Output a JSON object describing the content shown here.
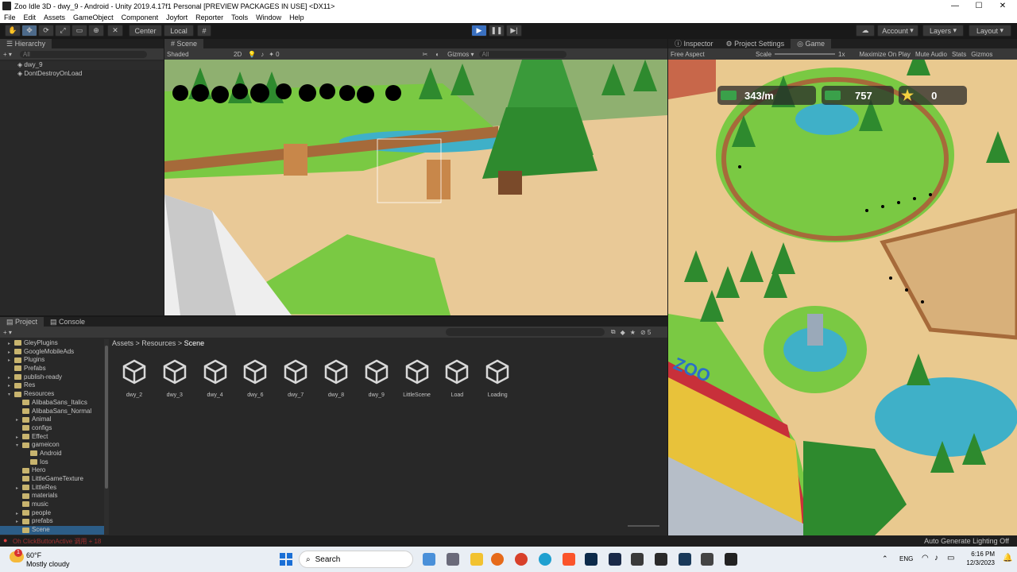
{
  "window": {
    "title": "Zoo Idle 3D - dwy_9 - Android - Unity 2019.4.17f1 Personal [PREVIEW PACKAGES IN USE] <DX11>",
    "minimize": "—",
    "maximize": "☐",
    "close": "✕"
  },
  "menu": [
    "File",
    "Edit",
    "Assets",
    "GameObject",
    "Component",
    "Joyfort",
    "Reporter",
    "Tools",
    "Window",
    "Help"
  ],
  "toolbar": {
    "center_label": "Center",
    "local_label": "Local",
    "account_label": "Account",
    "layers_label": "Layers",
    "layout_label": "Layout"
  },
  "hierarchy": {
    "tab": "Hierarchy",
    "search_placeholder": "All",
    "items": [
      "dwy_9",
      "DontDestroyOnLoad"
    ]
  },
  "scene": {
    "tab": "Scene",
    "shading": "Shaded",
    "mode_2d": "2D",
    "gizmos": "Gizmos",
    "search_placeholder": "All",
    "fx_count": "0"
  },
  "game": {
    "tabs": [
      "Inspector",
      "Project Settings",
      "Game"
    ],
    "aspect": "Free Aspect",
    "scale_label": "Scale",
    "scale_value": "1x",
    "maximize_on_play": "Maximize On Play",
    "mute_audio": "Mute Audio",
    "stats": "Stats",
    "gizmos": "Gizmos",
    "hud": {
      "income_rate": "343/m",
      "cash": "757",
      "stars": "0"
    },
    "zoo_sign": "ZOO"
  },
  "project": {
    "tabs": [
      "Project",
      "Console"
    ],
    "breadcrumb": [
      "Assets",
      "Resources",
      "Scene"
    ],
    "tree": [
      {
        "label": "GleyPlugins",
        "indent": 1,
        "arrow": "▸"
      },
      {
        "label": "GoogleMobileAds",
        "indent": 1,
        "arrow": "▸"
      },
      {
        "label": "Plugins",
        "indent": 1,
        "arrow": "▸"
      },
      {
        "label": "Prefabs",
        "indent": 1,
        "arrow": ""
      },
      {
        "label": "publish-ready",
        "indent": 1,
        "arrow": "▸"
      },
      {
        "label": "Res",
        "indent": 1,
        "arrow": "▸"
      },
      {
        "label": "Resources",
        "indent": 1,
        "arrow": "▾"
      },
      {
        "label": "AlibabaSans_Italics",
        "indent": 2,
        "arrow": ""
      },
      {
        "label": "AlibabaSans_Normal",
        "indent": 2,
        "arrow": ""
      },
      {
        "label": "Animal",
        "indent": 2,
        "arrow": "▸"
      },
      {
        "label": "configs",
        "indent": 2,
        "arrow": ""
      },
      {
        "label": "Effect",
        "indent": 2,
        "arrow": "▸"
      },
      {
        "label": "gameicon",
        "indent": 2,
        "arrow": "▾"
      },
      {
        "label": "Android",
        "indent": 3,
        "arrow": ""
      },
      {
        "label": "Ios",
        "indent": 3,
        "arrow": ""
      },
      {
        "label": "Hero",
        "indent": 2,
        "arrow": ""
      },
      {
        "label": "LittleGameTexture",
        "indent": 2,
        "arrow": ""
      },
      {
        "label": "LittleRes",
        "indent": 2,
        "arrow": "▸"
      },
      {
        "label": "materials",
        "indent": 2,
        "arrow": ""
      },
      {
        "label": "music",
        "indent": 2,
        "arrow": ""
      },
      {
        "label": "people",
        "indent": 2,
        "arrow": "▸"
      },
      {
        "label": "prefabs",
        "indent": 2,
        "arrow": "▸"
      },
      {
        "label": "Scene",
        "indent": 2,
        "arrow": ""
      }
    ],
    "assets": [
      "dwy_2",
      "dwy_3",
      "dwy_4",
      "dwy_6",
      "dwy_7",
      "dwy_8",
      "dwy_9",
      "LittleScene",
      "Load",
      "Loading"
    ],
    "hidden_count": "5"
  },
  "status": {
    "error_text": "Oh ClickButtonActive 调用 + 18",
    "lighting": "Auto Generate Lighting Off"
  },
  "taskbar": {
    "weather_temp": "60°F",
    "weather_desc": "Mostly cloudy",
    "search_label": "Search",
    "lang": "ENG",
    "time": "6:16 PM",
    "date": "12/3/2023",
    "badge": "1"
  },
  "colors": {
    "editor_bg": "#282828",
    "play_blue": "#3a70c0",
    "grass": "#7ac943",
    "path": "#e8c98f"
  }
}
